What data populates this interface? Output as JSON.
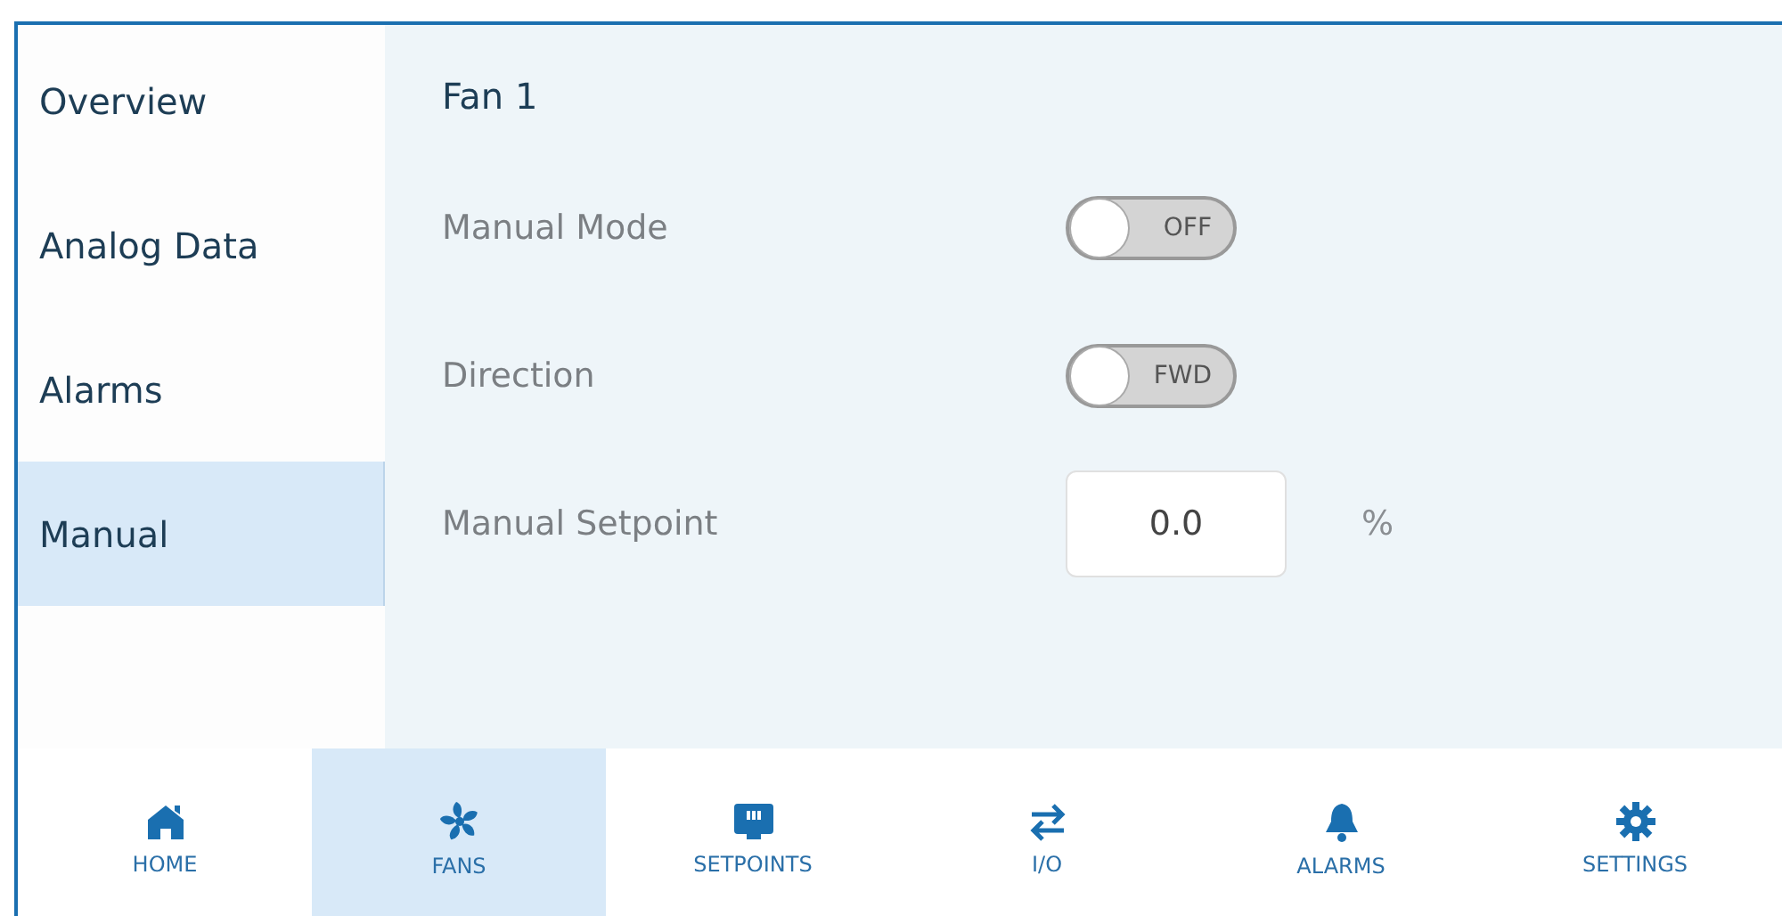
{
  "sidebar": {
    "items": [
      {
        "label": "Overview",
        "selected": false
      },
      {
        "label": "Analog Data",
        "selected": false
      },
      {
        "label": "Alarms",
        "selected": false
      },
      {
        "label": "Manual",
        "selected": true
      }
    ]
  },
  "panel": {
    "title": "Fan 1",
    "rows": [
      {
        "kind": "toggle",
        "label": "Manual Mode",
        "on": false,
        "state_text": "OFF"
      },
      {
        "kind": "toggle",
        "label": "Direction",
        "on": false,
        "state_text": "FWD"
      },
      {
        "kind": "number",
        "label": "Manual Setpoint",
        "value": "0.0",
        "unit": "%"
      }
    ]
  },
  "bottom_nav": [
    {
      "label": "HOME",
      "selected": false
    },
    {
      "label": "FANS",
      "selected": true
    },
    {
      "label": "SETPOINTS",
      "selected": false
    },
    {
      "label": "I/O",
      "selected": false
    },
    {
      "label": "ALARMS",
      "selected": false
    },
    {
      "label": "SETTINGS",
      "selected": false
    }
  ]
}
